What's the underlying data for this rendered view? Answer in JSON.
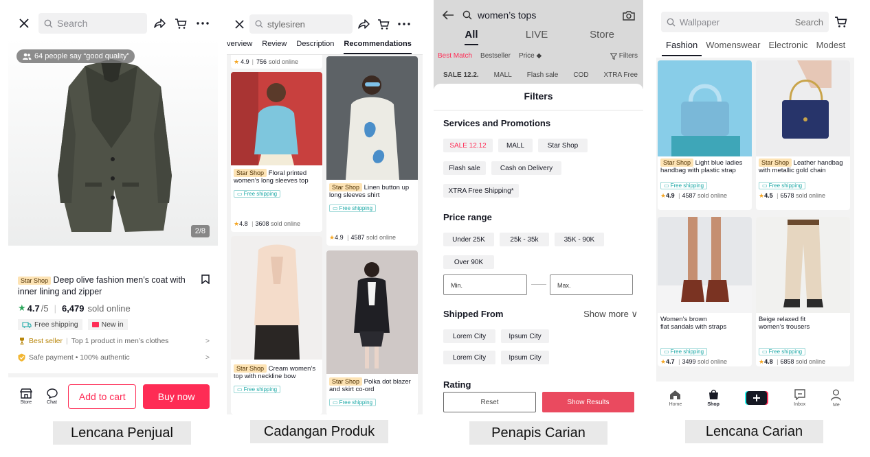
{
  "captions": [
    "Lencana Penjual",
    "Cadangan Produk",
    "Penapis Carian",
    "Lencana Carian"
  ],
  "colors": {
    "accent": "#fe2c55",
    "teal": "#1aa8a6",
    "star": "#f5a623",
    "starshop_bg": "#fde3b4"
  },
  "p1": {
    "search_placeholder": "Search",
    "badge": "64 people say “good quality”",
    "page_indicator": "2/8",
    "star_shop": "Star Shop",
    "title": "Deep olive fashion men’s coat with inner lining and zipper",
    "rating": "4.7",
    "rating_max": "/5",
    "sold_count": "6,479",
    "sold_label": "sold online",
    "free_shipping": "Free shipping",
    "new_in": "New in",
    "best_seller": "Best seller",
    "best_seller_detail": "Top 1 product in men’s clothes",
    "safe_payment": "Safe payment • 100% authentic",
    "store_label": "Store",
    "chat_label": "Chat",
    "add_to_cart": "Add to cart",
    "buy_now": "Buy now"
  },
  "p2": {
    "search_value": "stylesiren",
    "tabs": [
      "verview",
      "Review",
      "Description",
      "Recommendations"
    ],
    "top_rating": "4.9",
    "top_sold": "756",
    "sold_label": "sold online",
    "star_shop": "Star Shop",
    "free_shipping": "Free shipping",
    "cards": [
      {
        "title": "Floral printed women’s long sleeves top",
        "rating": "4.8",
        "sold": "3608"
      },
      {
        "title": "Linen button up long sleeves shirt",
        "rating": "4.9",
        "sold": "4587"
      },
      {
        "title": "Cream women’s top with neckline bow"
      },
      {
        "title": "Polka dot blazer and skirt co-ord"
      }
    ]
  },
  "p3": {
    "search_value": "women’s tops",
    "tabs": [
      "All",
      "LIVE",
      "Store"
    ],
    "sort": [
      "Best Match",
      "Bestseller",
      "Price ◆"
    ],
    "filters_btn": "Filters",
    "quick": [
      "SALE 12.2.",
      "MALL",
      "Flash sale",
      "COD",
      "XTRA Free"
    ],
    "sheet_title": "Filters",
    "services_title": "Services and Promotions",
    "services": [
      "SALE 12.12",
      "MALL",
      "Star Shop",
      "Flash sale",
      "Cash on Delivery",
      "XTRA Free Shipping*"
    ],
    "price_title": "Price range",
    "prices": [
      "Under 25K",
      "25k - 35k",
      "35K - 90K",
      "Over 90K"
    ],
    "min_placeholder": "Min.",
    "max_placeholder": "Max.",
    "shipped_title": "Shipped From",
    "show_more": "Show more ∨",
    "cities": [
      "Lorem City",
      "Ipsum City",
      "Lorem City",
      "Ipsum City"
    ],
    "rating_title": "Rating",
    "reset": "Reset",
    "show_results": "Show Results"
  },
  "p4": {
    "search_placeholder": "Wallpaper",
    "search_btn": "Search",
    "tabs": [
      "Fashion",
      "Womenswear",
      "Electronic",
      "Modest"
    ],
    "star_shop": "Star Shop",
    "free_shipping": "Free shipping",
    "sold_label": "sold online",
    "cards": [
      {
        "title": "Light blue ladies handbag with plastic strap",
        "rating": "4.9",
        "sold": "4587"
      },
      {
        "title": "Leather handbag with metallic gold chain",
        "rating": "4.5",
        "sold": "6578"
      },
      {
        "title_line1": "Women’s brown",
        "title_line2": "flat sandals with straps",
        "rating": "4.7",
        "sold": "3499"
      },
      {
        "title_line1": "Beige relaxed fit",
        "title_line2": "women’s trousers",
        "rating": "4.8",
        "sold": "6858"
      }
    ],
    "nav": [
      "Home",
      "Shop",
      "",
      "Inbox",
      "Me"
    ]
  }
}
